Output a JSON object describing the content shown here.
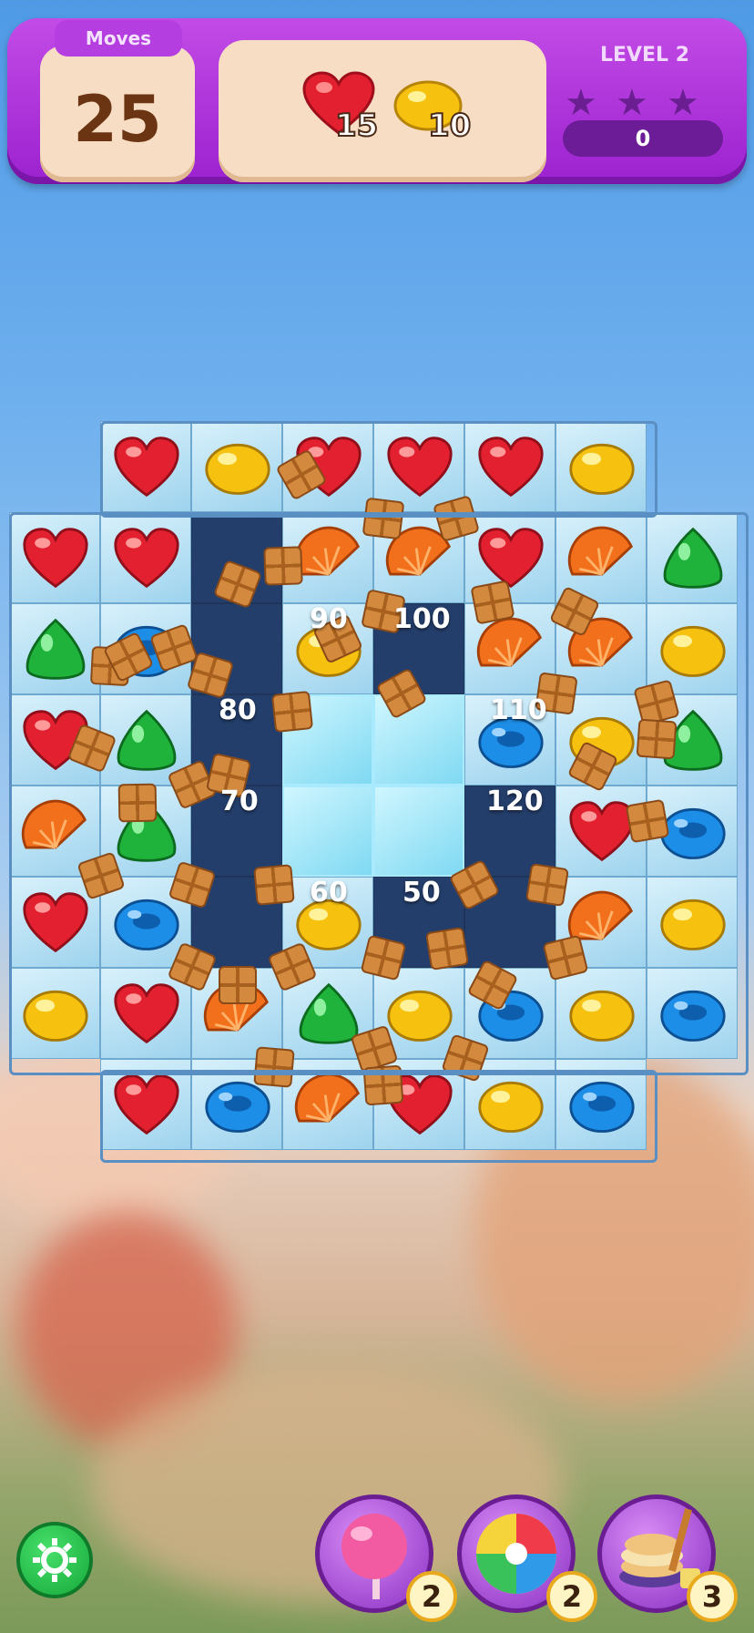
{
  "hud": {
    "moves_label": "Moves",
    "moves_value": "25",
    "goals": [
      {
        "icon": "red-heart-candy-icon",
        "count": "15"
      },
      {
        "icon": "yellow-lemon-candy-icon",
        "count": "10"
      }
    ],
    "level_label": "LEVEL 2",
    "stars_earned": 0,
    "stars_total": 3,
    "score": "0"
  },
  "board": {
    "score_popups": [
      "90",
      "100",
      "80",
      "110",
      "70",
      "120",
      "60",
      "50"
    ]
  },
  "boosters": [
    {
      "name": "lollipop-booster",
      "count": "2"
    },
    {
      "name": "color-swirl-booster",
      "count": "2"
    },
    {
      "name": "pancake-brush-booster",
      "count": "3"
    }
  ],
  "colors": {
    "heart": "#e3202f",
    "lemon": "#f7c20f",
    "green": "#20b33b",
    "blue": "#1d8ee8",
    "orange": "#f2701c",
    "hud_purple": "#a92fd8"
  }
}
